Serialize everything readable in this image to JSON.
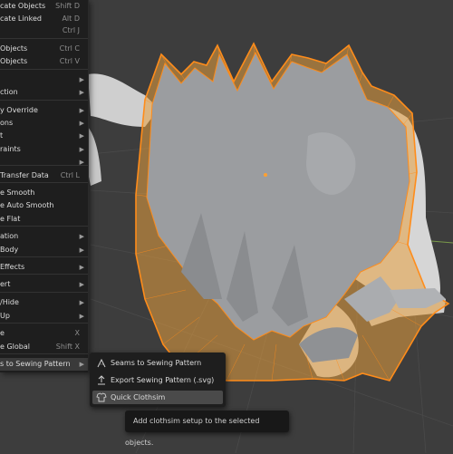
{
  "colors": {
    "viewport_bg": "#3d3d3d",
    "menu_bg": "#1e1e1e",
    "mesh_gray": "#9b9da0",
    "wire_orange": "#ff8c1a",
    "highlight": "#4a4a4a"
  },
  "object_menu": {
    "items": [
      {
        "label": "cate Objects",
        "shortcut": "Shift D"
      },
      {
        "label": "cate Linked",
        "shortcut": "Alt D"
      },
      {
        "label": "",
        "shortcut": "Ctrl J"
      },
      {
        "label": "Objects",
        "shortcut": "Ctrl C"
      },
      {
        "label": "Objects",
        "shortcut": "Ctrl V"
      },
      {
        "label": "",
        "submenu": true
      },
      {
        "label": "ction",
        "submenu": true
      },
      {
        "label": "y Override",
        "submenu": true
      },
      {
        "label": "ons",
        "submenu": true
      },
      {
        "label": "t",
        "submenu": true
      },
      {
        "label": "raints",
        "submenu": true
      },
      {
        "label": "",
        "submenu": true
      },
      {
        "label": "Transfer Data",
        "shortcut": "Ctrl L"
      },
      {
        "label": "e Smooth"
      },
      {
        "label": "e Auto Smooth"
      },
      {
        "label": "e Flat"
      },
      {
        "label": "ation",
        "submenu": true
      },
      {
        "label": "Body",
        "submenu": true
      },
      {
        "label": "Effects",
        "submenu": true
      },
      {
        "label": "ert",
        "submenu": true
      },
      {
        "label": "/Hide",
        "submenu": true
      },
      {
        "label": "Up",
        "submenu": true
      },
      {
        "label": "e",
        "shortcut": "X"
      },
      {
        "label": "e Global",
        "shortcut": "Shift X"
      },
      {
        "label": "s to Sewing Pattern",
        "submenu": true
      }
    ]
  },
  "sewing_submenu": {
    "items": [
      {
        "label": "Seams to Sewing Pattern",
        "icon": "seams-icon"
      },
      {
        "label": "Export Sewing Pattern (.svg)",
        "icon": "export-icon"
      },
      {
        "label": "Quick Clothsim",
        "icon": "shirt-icon"
      }
    ]
  },
  "tooltip": {
    "text": "Add clothsim setup to the selected objects."
  }
}
